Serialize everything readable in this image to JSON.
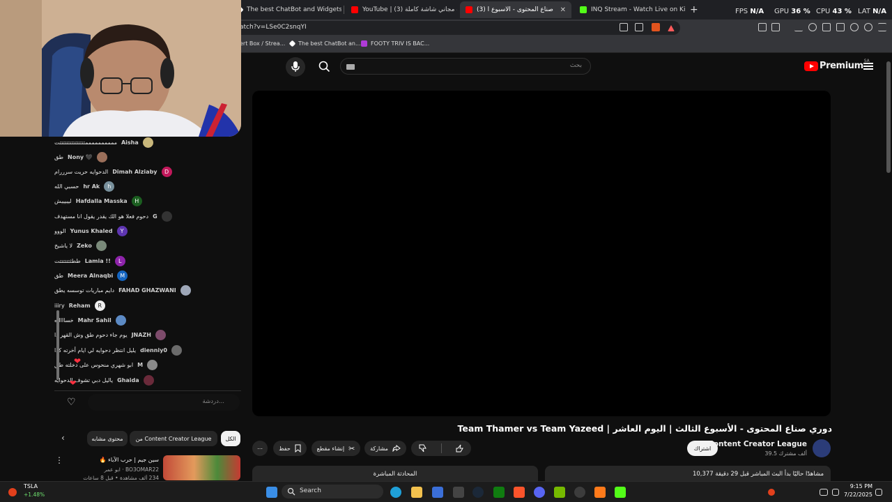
{
  "browser": {
    "tabs": [
      {
        "label": "The best ChatBot and Widgets for Ki",
        "color": "#ffffff"
      },
      {
        "label": "YouTube | البوت مجاني شاشة كاملة (3)",
        "color": "#ff0000"
      },
      {
        "label": "(3) دوري صناع المحتوى - الأسبوع ا",
        "color": "#ff0000",
        "close": "✕"
      },
      {
        "label": "INQ Stream - Watch Live on Kick",
        "color": "#53fc18"
      }
    ],
    "new_tab": "+",
    "url": "atch?v=LSe0C2snqYI",
    "bookmarks": [
      {
        "label": "ert Box / Strea..."
      },
      {
        "label": "The best ChatBot an..."
      },
      {
        "label": "FOOTY TRIV IS BAC..."
      }
    ],
    "stats": {
      "fps_label": "FPS",
      "fps_value": "N/A",
      "gpu_label": "GPU",
      "gpu_value": "36 %",
      "cpu_label": "CPU",
      "cpu_value": "43 %",
      "lat_label": "LAT",
      "lat_value": "N/A"
    }
  },
  "youtube": {
    "search_placeholder": "بحث",
    "logo_text": "Premium",
    "logo_region": "SA",
    "video_title": "دوري صناع المحتوى - الأسبوع الثالث | اليوم العاشر | Team Thamer vs Team Yazeed",
    "channel_name": "Content Creator League",
    "subscribers": "39.5 ألف مشترك",
    "subscribe_label": "اشتراك",
    "actions": {
      "share": "مشاركة",
      "clip": "إنشاء مقطع",
      "save": "حفظ",
      "more": "⋯"
    },
    "description_line": "10,377 مشاهدًا حاليًا  بدأ البث المباشر قبل 29 دقيقة",
    "live_chat_label": "المحادثة المباشرة",
    "chips": {
      "all": "الكل",
      "from_channel": "من Content Creator League",
      "similar": "محتوى مشابه"
    },
    "related": {
      "title": "سين جيم | حرب الآباء 🔥",
      "channel": "BO3OMAR22 · ابو عمر",
      "meta": "234 ألف مشاهدة • قبل 8 ساعات"
    }
  },
  "chat": {
    "input_placeholder": "دردشة...",
    "messages": [
      {
        "name": "Aisha",
        "text": "ممممممممممتتتتتتتتتتتتتتتت",
        "color": "#c9b77b",
        "initial": ""
      },
      {
        "name": "Nony 🖤",
        "text": "طق",
        "color": "#9b6f5a",
        "initial": ""
      },
      {
        "name": "Dimah Alziaby",
        "text": "الدحوايه حريت سرررام",
        "color": "#c2185b",
        "initial": "D"
      },
      {
        "name": "hr Ak",
        "text": "حسبي الله",
        "color": "#78909c",
        "initial": "h"
      },
      {
        "name": "Hafdalla Masska",
        "text": "ليييييش",
        "color": "#1b5e20",
        "initial": "H"
      },
      {
        "name": "G",
        "text": "دحوم فعلا هو الك يقدر يقول انا مستهدف",
        "color": "#333333",
        "initial": ""
      },
      {
        "name": "Yunus Khaled",
        "text": "الووو",
        "color": "#5e35b1",
        "initial": "Y"
      },
      {
        "name": "Zeko",
        "text": "لا ياشيخ",
        "color": "#7a8a7a",
        "initial": ""
      },
      {
        "name": "Lamia !!",
        "text": "ططثتتتتتتت",
        "color": "#8e24aa",
        "initial": "L"
      },
      {
        "name": "Meera Alnaqbi",
        "text": "طق",
        "color": "#1565c0",
        "initial": "M"
      },
      {
        "name": "FAHAD GHAZWANI",
        "text": "دايم مباريات توسسه يطق",
        "color": "#9ea7b8",
        "initial": ""
      },
      {
        "name": "Reham",
        "text": "iiiry",
        "color": "#eeeeee",
        "initial": "R"
      },
      {
        "name": "Mahr Sahil",
        "text": "خساااااه",
        "color": "#5c8ac4",
        "initial": ""
      },
      {
        "name": "JNAZH",
        "text": "يوم جاء دحوم طق وش القهر ذا",
        "color": "#7d4b6b",
        "initial": ""
      },
      {
        "name": "dienniy0",
        "text": "يليل انتظر دحوايه لي ايام أخرته كذا",
        "color": "#6b6b6b",
        "initial": ""
      },
      {
        "name": "M",
        "text": "ابو شهري منحوس على دخلته طق",
        "color": "#8a8a8a",
        "initial": ""
      },
      {
        "name": "Ghaida",
        "text": "ياليل دبي تشوف الدحوايه",
        "color": "#6a2a3a",
        "initial": ""
      }
    ]
  },
  "taskbar": {
    "stock_ticker": "TSLA",
    "stock_change": "+1.48%",
    "search_label": "Search",
    "time": "9:15 PM",
    "date": "7/22/2025"
  }
}
